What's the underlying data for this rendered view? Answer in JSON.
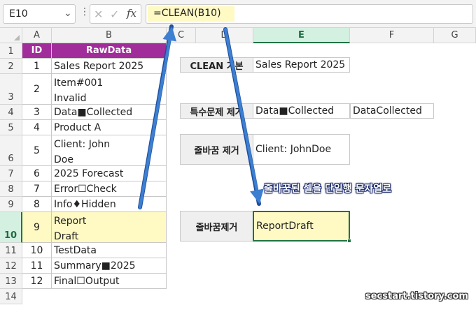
{
  "formula_bar": {
    "name_box": "E10",
    "chevron": "⌄",
    "dots": "⋮",
    "cancel": "✕",
    "confirm": "✓",
    "fx": "fx",
    "formula": "=CLEAN(B10)"
  },
  "columns": [
    "A",
    "B",
    "C",
    "D",
    "E",
    "F",
    "G"
  ],
  "selected_column": "E",
  "rows": [
    "1",
    "2",
    "3",
    "4",
    "5",
    "6",
    "7",
    "8",
    "9",
    "10",
    "11",
    "12",
    "13",
    "14"
  ],
  "selected_row": "10",
  "table": {
    "header_id": "ID",
    "header_data": "RawData",
    "records": [
      {
        "id": "1",
        "lines": [
          "Sales Report 2025"
        ]
      },
      {
        "id": "2",
        "lines": [
          "Item#001",
          "Invalid"
        ]
      },
      {
        "id": "3",
        "lines": [
          "Data■Collected"
        ]
      },
      {
        "id": "4",
        "lines": [
          "Product A"
        ]
      },
      {
        "id": "5",
        "lines": [
          "Client: John",
          "Doe"
        ]
      },
      {
        "id": "6",
        "lines": [
          "2025 Forecast"
        ]
      },
      {
        "id": "7",
        "lines": [
          "Error☐Check"
        ]
      },
      {
        "id": "8",
        "lines": [
          "Info♦Hidden"
        ]
      },
      {
        "id": "9",
        "lines": [
          "Report",
          "Draft"
        ]
      },
      {
        "id": "10",
        "lines": [
          "TestData"
        ]
      },
      {
        "id": "11",
        "lines": [
          "Summary■2025"
        ]
      },
      {
        "id": "12",
        "lines": [
          "Final☐Output"
        ]
      }
    ]
  },
  "examples": [
    {
      "label": "CLEAN 기본",
      "values": [
        "Sales Report 2025"
      ]
    },
    {
      "label": "특수문제 제거",
      "values": [
        "Data■Collected",
        "DataCollected"
      ]
    },
    {
      "label": "줄바꿈 제거",
      "values": [
        "Client: JohnDoe"
      ]
    },
    {
      "label": "줄바꿈제거",
      "values": [
        "ReportDraft"
      ]
    }
  ],
  "annotation": "줄바꿈된 셀을 단일행 문자열로",
  "watermark": "secstart.tistory.com",
  "colors": {
    "header_purple": "#a12d9a",
    "highlight_yellow": "#fff9c4",
    "selection_green": "#217346",
    "arrow_blue": "#3d7fd0"
  }
}
